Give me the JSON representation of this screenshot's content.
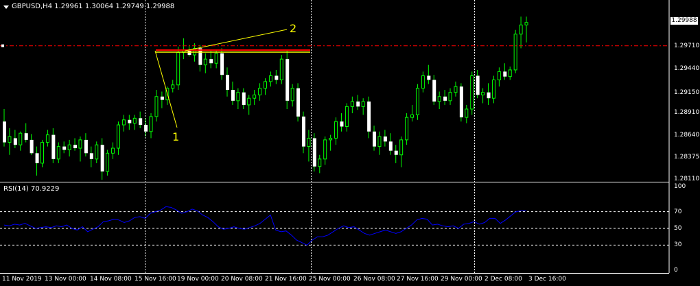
{
  "header": {
    "symbol": "GBPUSD,H4",
    "open": "1.29961",
    "high": "1.30064",
    "low": "1.29749",
    "close": "1.29988"
  },
  "rsi": {
    "label": "RSI(14) 70.9229",
    "levels": [
      "100",
      "70",
      "50",
      "30",
      "0"
    ],
    "line_color": "#0000ff"
  },
  "price_axis": {
    "current_price": "1.29988",
    "labels": [
      "1.29710",
      "1.29440",
      "1.29150",
      "1.28910",
      "1.28640",
      "1.28375",
      "1.28110"
    ]
  },
  "time_axis": {
    "labels": [
      "11 Nov 2019",
      "13 Nov 00:00",
      "14 Nov 08:00",
      "15 Nov 16:00",
      "19 Nov 00:00",
      "20 Nov 08:00",
      "21 Nov 16:00",
      "25 Nov 00:00",
      "26 Nov 08:00",
      "27 Nov 16:00",
      "29 Nov 00:00",
      "2 Dec 08:00",
      "3 Dec 16:00"
    ]
  },
  "annotations": [
    "1",
    "2"
  ],
  "colors": {
    "background": "#000000",
    "candle": "#00ff00",
    "annotation": "#ffff00",
    "level_line": "#ff0000",
    "current_price_line": "#ff0000",
    "separator": "#ffffff"
  },
  "chart_data": {
    "type": "candlestick",
    "price_range": [
      1.2811,
      1.3008
    ],
    "current_level": 1.2971,
    "resistance_level": 1.2965,
    "series": [
      {
        "ohlc": [
          [
            1.288,
            1.2895,
            1.285,
            1.2855
          ],
          [
            1.2855,
            1.2872,
            1.284,
            1.2862
          ],
          [
            1.286,
            1.287,
            1.2848,
            1.2852
          ],
          [
            1.2852,
            1.2868,
            1.2845,
            1.2866
          ],
          [
            1.2866,
            1.2878,
            1.2855,
            1.2858
          ],
          [
            1.2858,
            1.2865,
            1.284,
            1.2842
          ],
          [
            1.2842,
            1.285,
            1.2815,
            1.283
          ],
          [
            1.283,
            1.2858,
            1.2825,
            1.2855
          ],
          [
            1.2855,
            1.287,
            1.285,
            1.2864
          ],
          [
            1.2864,
            1.2872,
            1.283,
            1.2835
          ],
          [
            1.2835,
            1.2855,
            1.283,
            1.285
          ],
          [
            1.285,
            1.2856,
            1.2842,
            1.2846
          ],
          [
            1.2846,
            1.2858,
            1.2838,
            1.2852
          ],
          [
            1.2852,
            1.286,
            1.2845,
            1.2848
          ],
          [
            1.2848,
            1.2862,
            1.2832,
            1.2858
          ],
          [
            1.2858,
            1.2866,
            1.2838,
            1.2842
          ],
          [
            1.2842,
            1.285,
            1.2825,
            1.2835
          ],
          [
            1.2835,
            1.2856,
            1.283,
            1.2852
          ],
          [
            1.2852,
            1.286,
            1.281,
            1.282
          ],
          [
            1.282,
            1.2846,
            1.2815,
            1.2842
          ],
          [
            1.2842,
            1.2855,
            1.2835,
            1.2848
          ],
          [
            1.2848,
            1.288,
            1.284,
            1.2876
          ],
          [
            1.2876,
            1.2888,
            1.2868,
            1.2882
          ],
          [
            1.2882,
            1.2888,
            1.287,
            1.2878
          ],
          [
            1.2878,
            1.2888,
            1.287,
            1.2884
          ],
          [
            1.2884,
            1.2892,
            1.2872,
            1.2876
          ],
          [
            1.2876,
            1.2884,
            1.2862,
            1.2868
          ],
          [
            1.2868,
            1.289,
            1.286,
            1.2886
          ],
          [
            1.2886,
            1.2918,
            1.288,
            1.291
          ],
          [
            1.291,
            1.2916,
            1.2896,
            1.2906
          ],
          [
            1.2906,
            1.2922,
            1.29,
            1.292
          ],
          [
            1.292,
            1.293,
            1.2915,
            1.2924
          ],
          [
            1.2924,
            1.297,
            1.2918,
            1.2963
          ],
          [
            1.2963,
            1.298,
            1.2955,
            1.2966
          ],
          [
            1.2966,
            1.2972,
            1.2958,
            1.296
          ],
          [
            1.296,
            1.2974,
            1.2952,
            1.2968
          ],
          [
            1.2968,
            1.2972,
            1.294,
            1.2948
          ],
          [
            1.2948,
            1.2962,
            1.2938,
            1.2955
          ],
          [
            1.2955,
            1.2965,
            1.2944,
            1.295
          ],
          [
            1.295,
            1.2966,
            1.2944,
            1.2962
          ],
          [
            1.2962,
            1.2968,
            1.293,
            1.2936
          ],
          [
            1.2936,
            1.2945,
            1.291,
            1.2918
          ],
          [
            1.2918,
            1.2928,
            1.29,
            1.2905
          ],
          [
            1.2905,
            1.292,
            1.2895,
            1.2915
          ],
          [
            1.2915,
            1.292,
            1.2895,
            1.29
          ],
          [
            1.29,
            1.2912,
            1.2888,
            1.2908
          ],
          [
            1.2908,
            1.2918,
            1.29,
            1.2912
          ],
          [
            1.2912,
            1.2926,
            1.2905,
            1.292
          ],
          [
            1.292,
            1.2932,
            1.2912,
            1.2928
          ],
          [
            1.2928,
            1.294,
            1.2922,
            1.2935
          ],
          [
            1.2935,
            1.2942,
            1.2925,
            1.293
          ],
          [
            1.293,
            1.296,
            1.2925,
            1.2955
          ],
          [
            1.2955,
            1.2965,
            1.2895,
            1.2905
          ],
          [
            1.2905,
            1.2925,
            1.2898,
            1.292
          ],
          [
            1.292,
            1.2926,
            1.288,
            1.2886
          ],
          [
            1.2886,
            1.2892,
            1.2842,
            1.285
          ],
          [
            1.285,
            1.287,
            1.2832,
            1.286
          ],
          [
            1.286,
            1.2866,
            1.282,
            1.2826
          ],
          [
            1.2826,
            1.284,
            1.2818,
            1.2835
          ],
          [
            1.2835,
            1.2862,
            1.2828,
            1.2858
          ],
          [
            1.2858,
            1.2864,
            1.2845,
            1.286
          ],
          [
            1.286,
            1.2885,
            1.2852,
            1.288
          ],
          [
            1.288,
            1.289,
            1.2868,
            1.2874
          ],
          [
            1.2874,
            1.2902,
            1.2868,
            1.2898
          ],
          [
            1.2898,
            1.291,
            1.289,
            1.2904
          ],
          [
            1.2904,
            1.2912,
            1.2894,
            1.2898
          ],
          [
            1.2898,
            1.2908,
            1.2888,
            1.2904
          ],
          [
            1.2904,
            1.291,
            1.286,
            1.2868
          ],
          [
            1.2868,
            1.2875,
            1.2845,
            1.285
          ],
          [
            1.285,
            1.2868,
            1.284,
            1.2862
          ],
          [
            1.2862,
            1.287,
            1.285,
            1.2856
          ],
          [
            1.2856,
            1.2866,
            1.284,
            1.2845
          ],
          [
            1.2845,
            1.2852,
            1.283,
            1.284
          ],
          [
            1.284,
            1.2862,
            1.2825,
            1.2858
          ],
          [
            1.2858,
            1.289,
            1.2852,
            1.2885
          ],
          [
            1.2885,
            1.29,
            1.288,
            1.2888
          ],
          [
            1.2888,
            1.2925,
            1.2882,
            1.292
          ],
          [
            1.292,
            1.294,
            1.2915,
            1.2935
          ],
          [
            1.2935,
            1.2948,
            1.2925,
            1.293
          ],
          [
            1.293,
            1.2936,
            1.29,
            1.2904
          ],
          [
            1.2904,
            1.2916,
            1.2895,
            1.291
          ],
          [
            1.291,
            1.2918,
            1.29,
            1.2905
          ],
          [
            1.2905,
            1.292,
            1.29,
            1.2915
          ],
          [
            1.2915,
            1.2928,
            1.291,
            1.2922
          ],
          [
            1.2922,
            1.2926,
            1.288,
            1.2885
          ],
          [
            1.2885,
            1.29,
            1.2878,
            1.2895
          ],
          [
            1.2895,
            1.294,
            1.2888,
            1.2935
          ],
          [
            1.2935,
            1.2942,
            1.2908,
            1.2912
          ],
          [
            1.2912,
            1.292,
            1.2902,
            1.2915
          ],
          [
            1.2915,
            1.2926,
            1.29,
            1.2908
          ],
          [
            1.2908,
            1.2935,
            1.2902,
            1.293
          ],
          [
            1.293,
            1.2945,
            1.2922,
            1.294
          ],
          [
            1.294,
            1.295,
            1.293,
            1.2934
          ],
          [
            1.2934,
            1.2946,
            1.293,
            1.2942
          ],
          [
            1.2942,
            1.299,
            1.2938,
            1.2985
          ],
          [
            1.2985,
            1.3006,
            1.2968,
            1.2996
          ],
          [
            1.2996,
            1.3006,
            1.2975,
            1.2999
          ]
        ]
      }
    ],
    "rsi_series": [
      54,
      53,
      55,
      54,
      56,
      53,
      50,
      51,
      52,
      51,
      53,
      52,
      54,
      50,
      48,
      52,
      46,
      49,
      52,
      58,
      59,
      61,
      60,
      57,
      59,
      63,
      64,
      62,
      68,
      70,
      72,
      76,
      75,
      72,
      68,
      70,
      73,
      71,
      66,
      63,
      58,
      52,
      49,
      50,
      52,
      50,
      49,
      51,
      53,
      56,
      61,
      66,
      48,
      46,
      47,
      42,
      36,
      33,
      30,
      36,
      40,
      40,
      42,
      46,
      50,
      53,
      51,
      52,
      48,
      44,
      42,
      44,
      46,
      48,
      46,
      44,
      46,
      50,
      54,
      60,
      62,
      61,
      54,
      55,
      53,
      52,
      53,
      50,
      55,
      56,
      58,
      55,
      57,
      62,
      62,
      56,
      60,
      65,
      70,
      71,
      71
    ]
  }
}
